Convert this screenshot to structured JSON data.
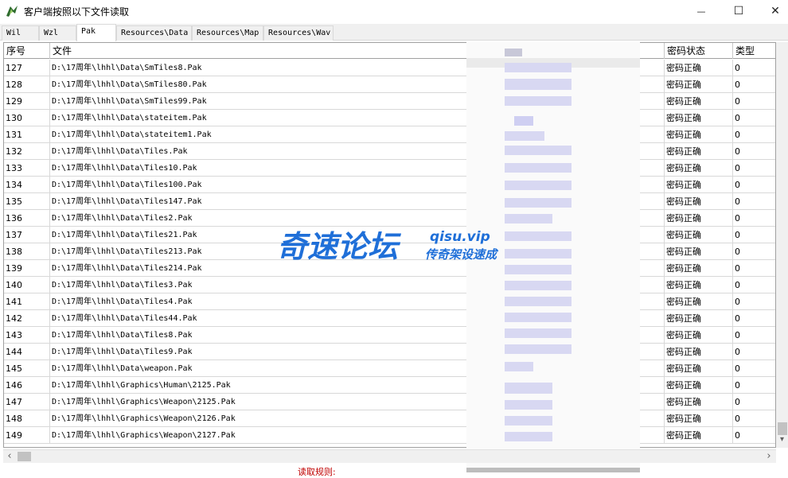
{
  "window": {
    "title": "客户端按照以下文件读取",
    "minimize_glyph": "—",
    "maximize_glyph": "☐",
    "close_glyph": "✕"
  },
  "tabs": [
    {
      "label": "Wil",
      "active": false
    },
    {
      "label": "Wzl",
      "active": false
    },
    {
      "label": "Pak",
      "active": true
    },
    {
      "label": "Resources\\Data",
      "active": false
    },
    {
      "label": "Resources\\Map",
      "active": false
    },
    {
      "label": "Resources\\Wav",
      "active": false
    }
  ],
  "table": {
    "headers": [
      "序号",
      "文件",
      "密码状态",
      "类型"
    ],
    "rows": [
      {
        "no": "127",
        "file": "D:\\17周年\\lhhl\\Data\\SmTiles8.Pak",
        "status": "密码正确",
        "type": "0"
      },
      {
        "no": "128",
        "file": "D:\\17周年\\lhhl\\Data\\SmTiles80.Pak",
        "status": "密码正确",
        "type": "0"
      },
      {
        "no": "129",
        "file": "D:\\17周年\\lhhl\\Data\\SmTiles99.Pak",
        "status": "密码正确",
        "type": "0"
      },
      {
        "no": "130",
        "file": "D:\\17周年\\lhhl\\Data\\stateitem.Pak",
        "status": "密码正确",
        "type": "0"
      },
      {
        "no": "131",
        "file": "D:\\17周年\\lhhl\\Data\\stateitem1.Pak",
        "status": "密码正确",
        "type": "0"
      },
      {
        "no": "132",
        "file": "D:\\17周年\\lhhl\\Data\\Tiles.Pak",
        "status": "密码正确",
        "type": "0"
      },
      {
        "no": "133",
        "file": "D:\\17周年\\lhhl\\Data\\Tiles10.Pak",
        "status": "密码正确",
        "type": "0"
      },
      {
        "no": "134",
        "file": "D:\\17周年\\lhhl\\Data\\Tiles100.Pak",
        "status": "密码正确",
        "type": "0"
      },
      {
        "no": "135",
        "file": "D:\\17周年\\lhhl\\Data\\Tiles147.Pak",
        "status": "密码正确",
        "type": "0"
      },
      {
        "no": "136",
        "file": "D:\\17周年\\lhhl\\Data\\Tiles2.Pak",
        "status": "密码正确",
        "type": "0"
      },
      {
        "no": "137",
        "file": "D:\\17周年\\lhhl\\Data\\Tiles21.Pak",
        "status": "密码正确",
        "type": "0"
      },
      {
        "no": "138",
        "file": "D:\\17周年\\lhhl\\Data\\Tiles213.Pak",
        "status": "密码正确",
        "type": "0"
      },
      {
        "no": "139",
        "file": "D:\\17周年\\lhhl\\Data\\Tiles214.Pak",
        "status": "密码正确",
        "type": "0"
      },
      {
        "no": "140",
        "file": "D:\\17周年\\lhhl\\Data\\Tiles3.Pak",
        "status": "密码正确",
        "type": "0"
      },
      {
        "no": "141",
        "file": "D:\\17周年\\lhhl\\Data\\Tiles4.Pak",
        "status": "密码正确",
        "type": "0"
      },
      {
        "no": "142",
        "file": "D:\\17周年\\lhhl\\Data\\Tiles44.Pak",
        "status": "密码正确",
        "type": "0"
      },
      {
        "no": "143",
        "file": "D:\\17周年\\lhhl\\Data\\Tiles8.Pak",
        "status": "密码正确",
        "type": "0"
      },
      {
        "no": "144",
        "file": "D:\\17周年\\lhhl\\Data\\Tiles9.Pak",
        "status": "密码正确",
        "type": "0"
      },
      {
        "no": "145",
        "file": "D:\\17周年\\lhhl\\Data\\weapon.Pak",
        "status": "密码正确",
        "type": "0"
      },
      {
        "no": "146",
        "file": "D:\\17周年\\lhhl\\Graphics\\Human\\2125.Pak",
        "status": "密码正确",
        "type": "0"
      },
      {
        "no": "147",
        "file": "D:\\17周年\\lhhl\\Graphics\\Weapon\\2125.Pak",
        "status": "密码正确",
        "type": "0"
      },
      {
        "no": "148",
        "file": "D:\\17周年\\lhhl\\Graphics\\Weapon\\2126.Pak",
        "status": "密码正确",
        "type": "0"
      },
      {
        "no": "149",
        "file": "D:\\17周年\\lhhl\\Graphics\\Weapon\\2127.Pak",
        "status": "密码正确",
        "type": "0"
      }
    ]
  },
  "watermark": {
    "main": "奇速论坛",
    "domain": "qisu.vip",
    "sub": "传奇架设速成"
  },
  "footer": {
    "label": "读取规则:"
  },
  "scrollbars": {
    "left_arrow": "‹",
    "right_arrow": "›",
    "down_arrow": "▾"
  },
  "colors": {
    "watermark_blue": "#1f6fd8",
    "footer_red": "#c00000",
    "blur_tint": "#d6d6f4"
  }
}
